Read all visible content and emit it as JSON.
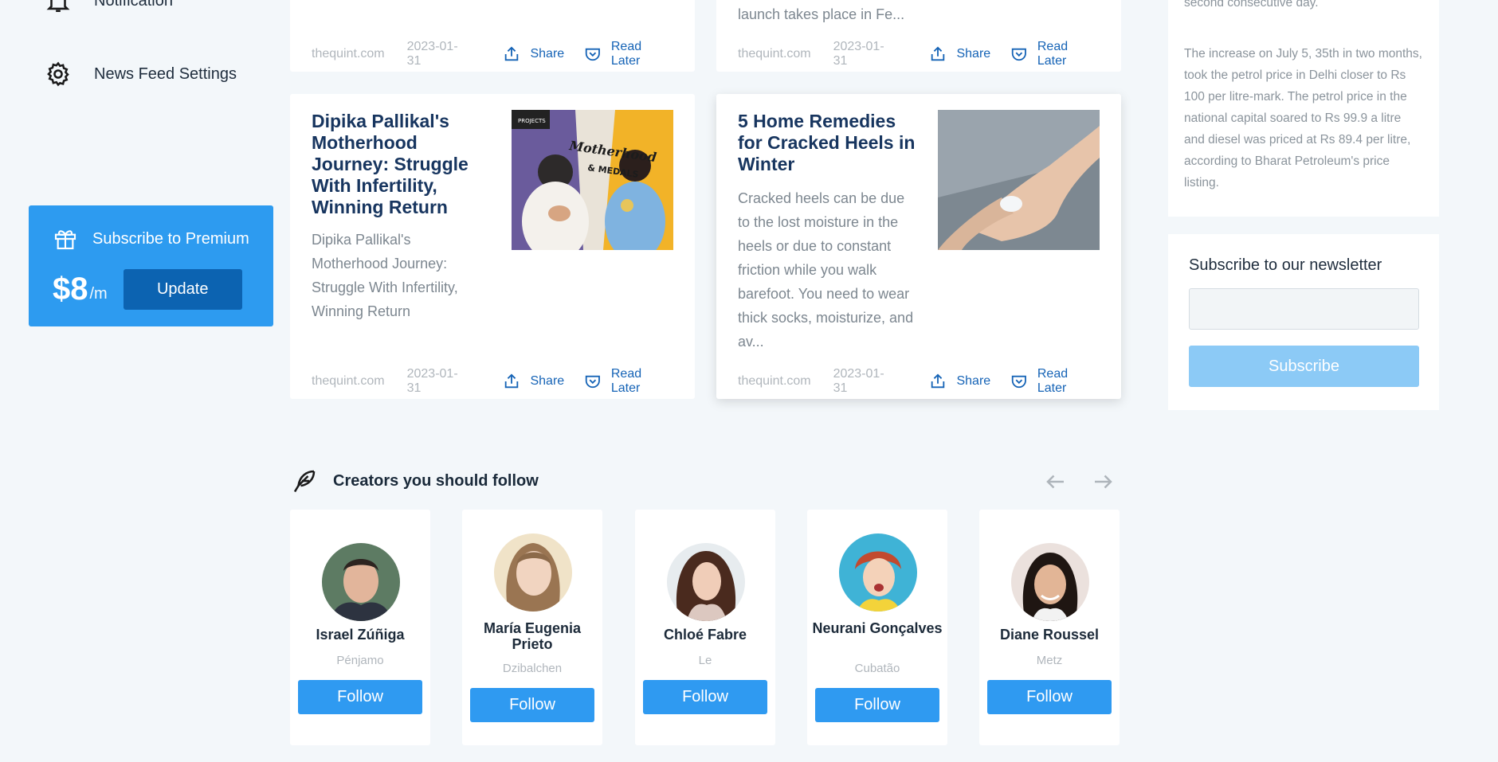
{
  "sidebar": {
    "items": [
      {
        "label": "Notification",
        "icon": "bell-icon"
      },
      {
        "label": "News Feed Settings",
        "icon": "gear-icon"
      }
    ],
    "premium": {
      "label": "Subscribe to Premium",
      "price": "$8",
      "period": "/m",
      "button": "Update"
    }
  },
  "cards": [
    {
      "tail": "",
      "source": "thequint.com",
      "date": "2023-01-31",
      "share": "Share",
      "read_later": "Read Later"
    },
    {
      "tail": "launch takes place in Fe...",
      "source": "thequint.com",
      "date": "2023-01-31",
      "share": "Share",
      "read_later": "Read Later"
    },
    {
      "title": "Dipika Pallikal's Motherhood Journey: Struggle With Infertility, Winning Return",
      "desc": "Dipika Pallikal's Motherhood Journey: Struggle With Infertility, Winning Return",
      "thumb_text": [
        "PROJECTS",
        "Motherhood",
        "& MEDALS"
      ],
      "source": "thequint.com",
      "date": "2023-01-31",
      "share": "Share",
      "read_later": "Read Later"
    },
    {
      "title": "5 Home Remedies for Cracked Heels in Winter",
      "desc": "Cracked heels can be due to the lost moisture in the heels or due to constant friction while you walk barefoot. You need to wear thick socks, moisturize, and av...",
      "source": "thequint.com",
      "date": "2023-01-31",
      "share": "Share",
      "read_later": "Read Later"
    }
  ],
  "right": {
    "news_tail": "second consecutive day.",
    "news_para": "The increase on July 5, 35th in two months, took the petrol price in Delhi closer to Rs 100 per litre-mark. The petrol price in the national capital soared to Rs 99.9 a litre and diesel was priced at Rs 89.4 per litre, according to Bharat Petroleum's price listing.",
    "newsletter": {
      "title": "Subscribe to our newsletter",
      "input_value": "",
      "button": "Subscribe"
    }
  },
  "creators": {
    "title": "Creators you should follow",
    "follow_label": "Follow",
    "items": [
      {
        "name": "Israel Zúñiga",
        "city": "Pénjamo"
      },
      {
        "name": "María Eugenia Prieto",
        "city": "Dzibalchen"
      },
      {
        "name": "Chloé Fabre",
        "city": "Le"
      },
      {
        "name": "Neurani Gonçalves",
        "city": "Cubatão"
      },
      {
        "name": "Diane Roussel",
        "city": "Metz"
      }
    ]
  },
  "colors": {
    "accent": "#2d9bf0",
    "link": "#1563b6",
    "title": "#17355f"
  }
}
